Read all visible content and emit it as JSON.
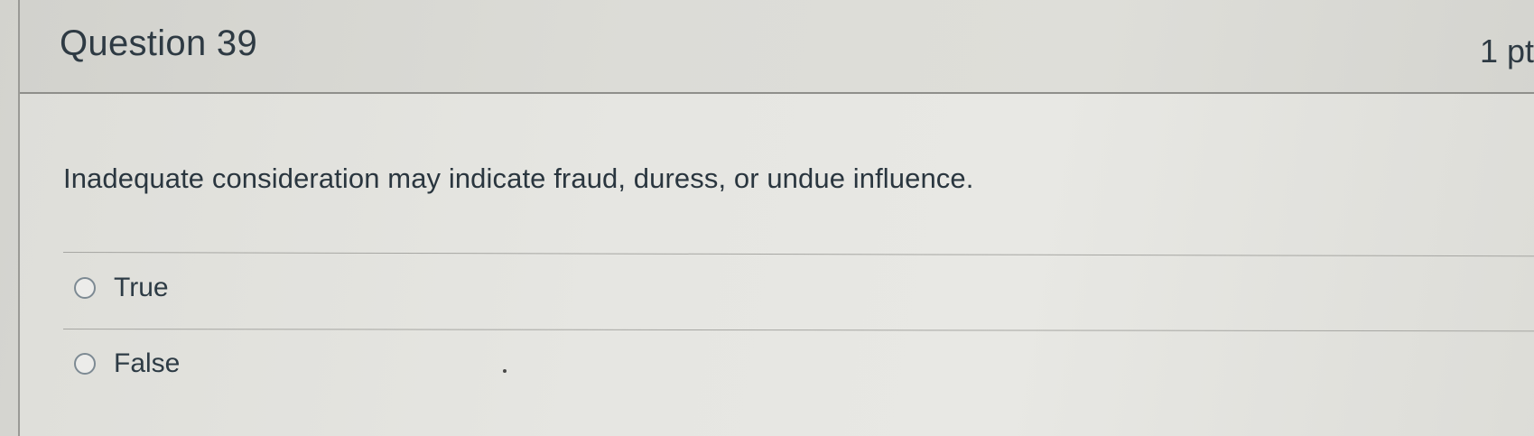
{
  "question": {
    "title": "Question 39",
    "points": "1 pt",
    "text": "Inadequate consideration may indicate fraud, duress, or undue influence.",
    "answers": [
      {
        "label": "True",
        "selected": false
      },
      {
        "label": "False",
        "selected": false
      }
    ]
  },
  "colors": {
    "text": "#2d3b45",
    "radio_border": "#7d8a93",
    "background": "#e4e4e0"
  }
}
